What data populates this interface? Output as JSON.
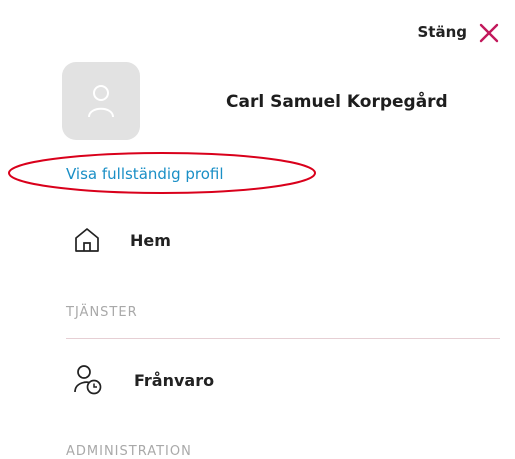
{
  "header": {
    "close_label": "Stäng",
    "close_icon": "close-icon",
    "close_color": "#c2185b"
  },
  "profile": {
    "name": "Carl Samuel Korpegård",
    "avatar_icon": "user-icon",
    "view_profile_link": "Visa fullständig profil"
  },
  "nav": {
    "home": {
      "label": "Hem",
      "icon": "home-icon"
    },
    "sections": [
      {
        "title": "TJÄNSTER",
        "items": [
          {
            "label": "Frånvaro",
            "icon": "user-clock-icon"
          }
        ]
      },
      {
        "title": "ADMINISTRATION",
        "items": []
      }
    ]
  },
  "colors": {
    "link": "#1a8fc6",
    "annotation": "#d9001b",
    "section_title": "#a9a9a9",
    "divider": "#e6cfd4"
  }
}
